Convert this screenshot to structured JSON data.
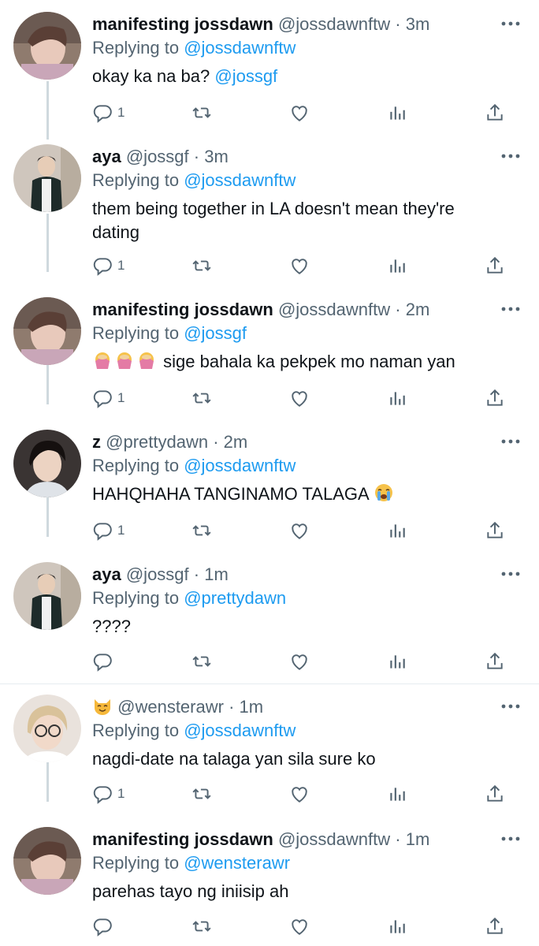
{
  "colors": {
    "accent": "#1d9bf0",
    "muted": "#536471",
    "text": "#0f1419",
    "thread_line": "#cfd9de"
  },
  "icons": {
    "reply": "reply-icon",
    "retweet": "retweet-icon",
    "like": "heart-icon",
    "views": "views-icon",
    "share": "share-icon",
    "more": "more-icon"
  },
  "tweets": [
    {
      "name": "manifesting jossdawn",
      "handle": "@jossdawnftw",
      "dot": "·",
      "time": "3m",
      "replying_label": "Replying to",
      "replying_to": "@jossdawnftw",
      "text": "okay ka na ba?",
      "text_mention": "@jossgf",
      "reply_count": "1"
    },
    {
      "name": "aya",
      "handle": "@jossgf",
      "dot": "·",
      "time": "3m",
      "replying_label": "Replying to",
      "replying_to": "@jossdawnftw",
      "text": "them being together in LA doesn't mean they're dating",
      "reply_count": "1"
    },
    {
      "name": "manifesting jossdawn",
      "handle": "@jossdawnftw",
      "dot": "·",
      "time": "2m",
      "replying_label": "Replying to",
      "replying_to": "@jossgf",
      "text": "sige bahala ka pekpek mo naman yan",
      "reply_count": "1"
    },
    {
      "name": "z",
      "handle": "@prettydawn",
      "dot": "·",
      "time": "2m",
      "replying_label": "Replying to",
      "replying_to": "@jossdawnftw",
      "text": "HAHQHAHA TANGINAMO TALAGA",
      "reply_count": "1"
    },
    {
      "name": "aya",
      "handle": "@jossgf",
      "dot": "·",
      "time": "1m",
      "replying_label": "Replying to",
      "replying_to": "@prettydawn",
      "text": "????",
      "reply_count": ""
    },
    {
      "name": "",
      "handle": "@wensterawr",
      "dot": "·",
      "time": "1m",
      "replying_label": "Replying to",
      "replying_to": "@jossdawnftw",
      "text": "nagdi-date na talaga yan sila sure ko",
      "reply_count": "1"
    },
    {
      "name": "manifesting jossdawn",
      "handle": "@jossdawnftw",
      "dot": "·",
      "time": "1m",
      "replying_label": "Replying to",
      "replying_to": "@wensterawr",
      "text": "parehas tayo ng iniisip ah",
      "reply_count": ""
    }
  ]
}
